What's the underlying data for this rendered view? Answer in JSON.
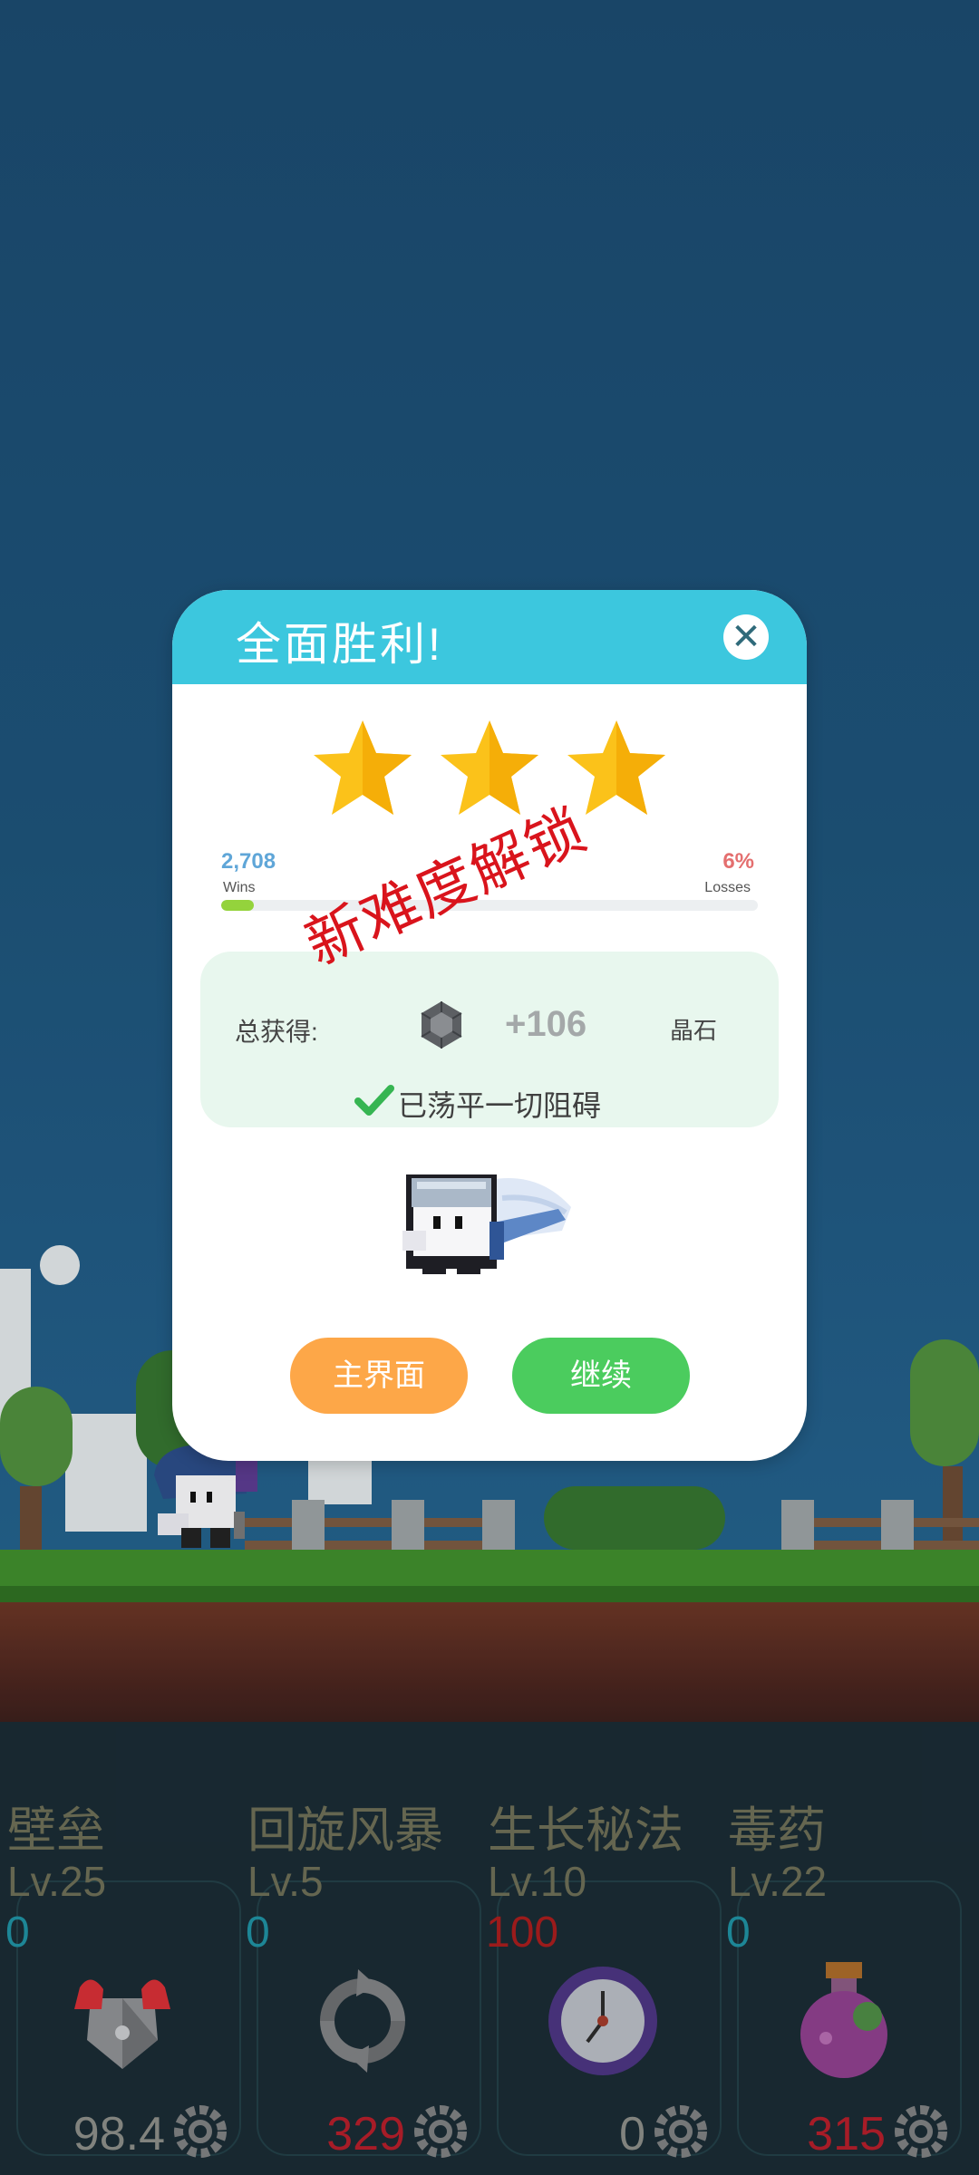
{
  "dialog": {
    "title": "全面胜利!",
    "close": "✕",
    "stars": 3,
    "stats": {
      "wins_value": "2,708",
      "wins_label": "Wins",
      "losses_value": "6%",
      "losses_label": "Losses",
      "progress_fraction": 0.06
    },
    "stamp": "新难度解锁",
    "rewards": {
      "label": "总获得:",
      "amount": "+106",
      "unit": "晶石",
      "status": "已荡平一切阻碍"
    },
    "buttons": {
      "home": "主界面",
      "continue": "继续"
    }
  },
  "skills": [
    {
      "name": "壁垒",
      "level": "Lv.25",
      "count": "0",
      "value": "98.4",
      "icon": "armor-icon"
    },
    {
      "name": "回旋风暴",
      "level": "Lv.5",
      "count": "0",
      "value": "329",
      "icon": "whirlwind-icon"
    },
    {
      "name": "生长秘法",
      "level": "Lv.10",
      "count": "100",
      "value": "0",
      "icon": "clock-icon"
    },
    {
      "name": "毒药",
      "level": "Lv.22",
      "count": "0",
      "value": "315",
      "icon": "potion-icon"
    }
  ],
  "colors": {
    "header": "#3cc7de",
    "home_button": "#fda748",
    "continue_button": "#4bcc5e",
    "stamp": "#d9141c",
    "star": "#fbc21a"
  }
}
